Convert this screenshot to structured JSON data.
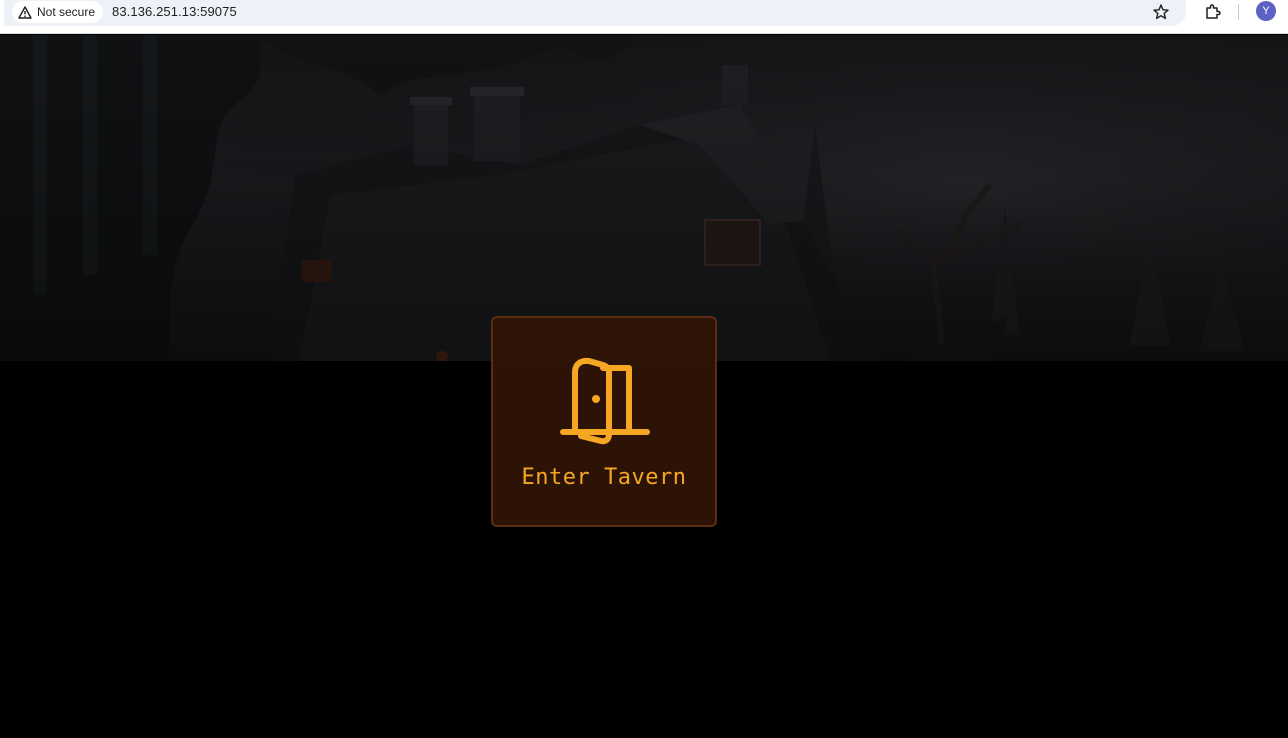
{
  "browser": {
    "security_label": "Not secure",
    "url": "83.136.251.13:59075",
    "avatar_initial": "Y",
    "icons": [
      "warning-icon",
      "star-icon",
      "extensions-icon"
    ]
  },
  "page": {
    "enter_button": {
      "label": "Enter Tavern",
      "icon": "door-icon"
    }
  },
  "colors": {
    "accent": "#f5a623",
    "card_background": "#2e1406",
    "card_border": "#5c2c12",
    "page_background": "#000000"
  }
}
